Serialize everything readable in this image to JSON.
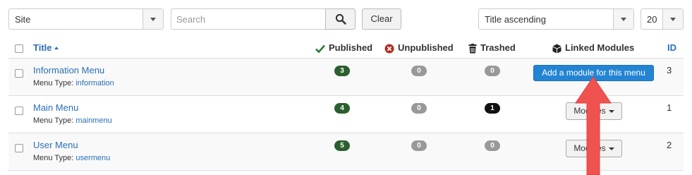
{
  "toolbar": {
    "site_select_value": "Site",
    "search_placeholder": "Search",
    "clear_label": "Clear",
    "sort_select_value": "Title ascending",
    "limit_select_value": "20"
  },
  "table": {
    "headers": {
      "title": "Title",
      "published": "Published",
      "unpublished": "Unpublished",
      "trashed": "Trashed",
      "linked_modules": "Linked Modules",
      "id": "ID"
    },
    "menu_type_label": "Menu Type:",
    "rows": [
      {
        "title": "Information Menu",
        "menu_type": "information",
        "published": "3",
        "unpublished": "0",
        "trashed": "0",
        "linked": "Add a module for this menu",
        "id": "3"
      },
      {
        "title": "Main Menu",
        "menu_type": "mainmenu",
        "published": "4",
        "unpublished": "0",
        "trashed": "1",
        "linked": "Modules",
        "id": "1"
      },
      {
        "title": "User Menu",
        "menu_type": "usermenu",
        "published": "5",
        "unpublished": "0",
        "trashed": "0",
        "linked": "Modules",
        "id": "2"
      }
    ]
  },
  "colors": {
    "link": "#2a6fb5",
    "published_badge": "#2b5f2e",
    "zero_badge": "#999999",
    "trashed_nonzero_badge": "#111111",
    "primary_button": "#2384d3",
    "annotation_arrow": "#f0524f"
  },
  "icons": {
    "search": "magnifier-icon",
    "published": "check-icon",
    "unpublished": "times-circle-icon",
    "trashed": "trash-icon",
    "linked_modules": "cube-icon"
  }
}
